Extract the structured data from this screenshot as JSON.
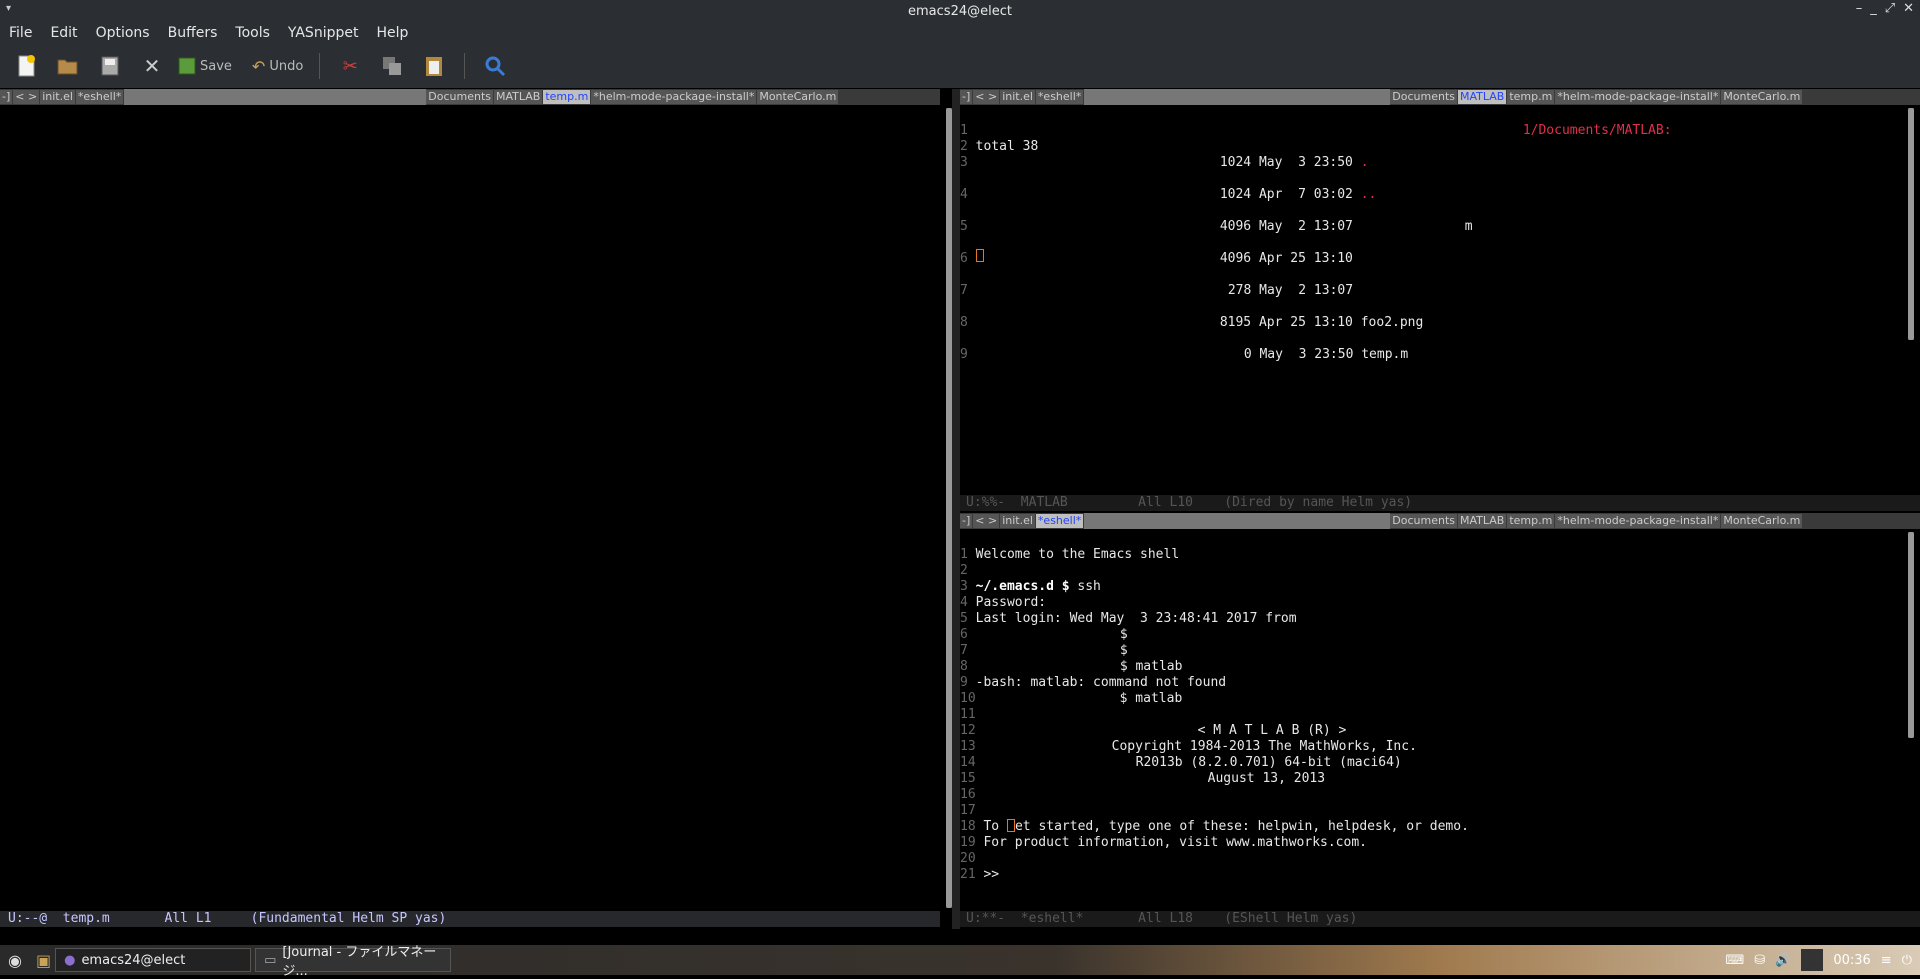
{
  "window": {
    "title": "emacs24@elect"
  },
  "menubar": [
    "File",
    "Edit",
    "Options",
    "Buffers",
    "Tools",
    "YASnippet",
    "Help"
  ],
  "toolbar": {
    "save_label": "Save",
    "undo_label": "Undo"
  },
  "tabs": {
    "left": [
      "-]",
      "< >",
      "init.el",
      "*eshell*",
      "Documents",
      "MATLAB",
      "temp.m",
      "*helm-mode-package-install*",
      "MonteCarlo.m"
    ],
    "right_top": [
      "-]",
      "< >",
      "init.el",
      "*eshell*",
      "Documents",
      "MATLAB",
      "temp.m",
      "*helm-mode-package-install*",
      "MonteCarlo.m"
    ],
    "right_bottom": [
      "-]",
      "< >",
      "init.el",
      "*eshell*",
      "Documents",
      "MATLAB",
      "temp.m",
      "*helm-mode-package-install*",
      "MonteCarlo.m"
    ]
  },
  "left_pane": {
    "modeline": "U:--@  temp.m       All L1     (Fundamental Helm SP yas)"
  },
  "dired": {
    "header_path": "1/Documents/MATLAB:",
    "total": "total 38",
    "entries": [
      {
        "ln": "3",
        "size": "1024",
        "date": "May  3 23:50",
        "name": "."
      },
      {
        "ln": "4",
        "size": "1024",
        "date": "Apr  7 03:02",
        "name": ".."
      },
      {
        "ln": "5",
        "size": "4096",
        "date": "May  2 13:07",
        "name": "m"
      },
      {
        "ln": "6",
        "size": "4096",
        "date": "Apr 25 13:10",
        "name": ""
      },
      {
        "ln": "7",
        "size": "278",
        "date": "May  2 13:07",
        "name": ""
      },
      {
        "ln": "8",
        "size": "8195",
        "date": "Apr 25 13:10",
        "name": "foo2.png"
      },
      {
        "ln": "9",
        "size": "0",
        "date": "May  3 23:50",
        "name": "temp.m"
      }
    ],
    "modeline": "U:%%-  MATLAB         All L10    (Dired by name Helm yas)"
  },
  "eshell": {
    "welcome": "Welcome to the Emacs shell",
    "prompt_dir": "~/.emacs.d $",
    "cmd_ssh": " ssh",
    "password": "Password:",
    "last_login": "Last login: Wed May  3 23:48:41 2017 from",
    "dollar": "$",
    "cmd_matlab": "$ matlab",
    "bash_error": "-bash: matlab: command not found",
    "matlab_banner": "< M A T L A B (R) >",
    "copyright": "Copyright 1984-2013 The MathWorks, Inc.",
    "version": "R2013b (8.2.0.701) 64-bit (maci64)",
    "date": "August 13, 2013",
    "get_started_a": "To ",
    "get_started_b": "et started, type one of these: helpwin, helpdesk, or demo.",
    "product_info": "For product information, visit www.mathworks.com.",
    "matlab_prompt": ">>",
    "modeline": "U:**-  *eshell*       All L18    (EShell Helm yas)"
  },
  "taskbar": {
    "tasks": [
      "emacs24@elect",
      "[Journal - ファイルマネージ..."
    ],
    "clock": "00:36"
  }
}
